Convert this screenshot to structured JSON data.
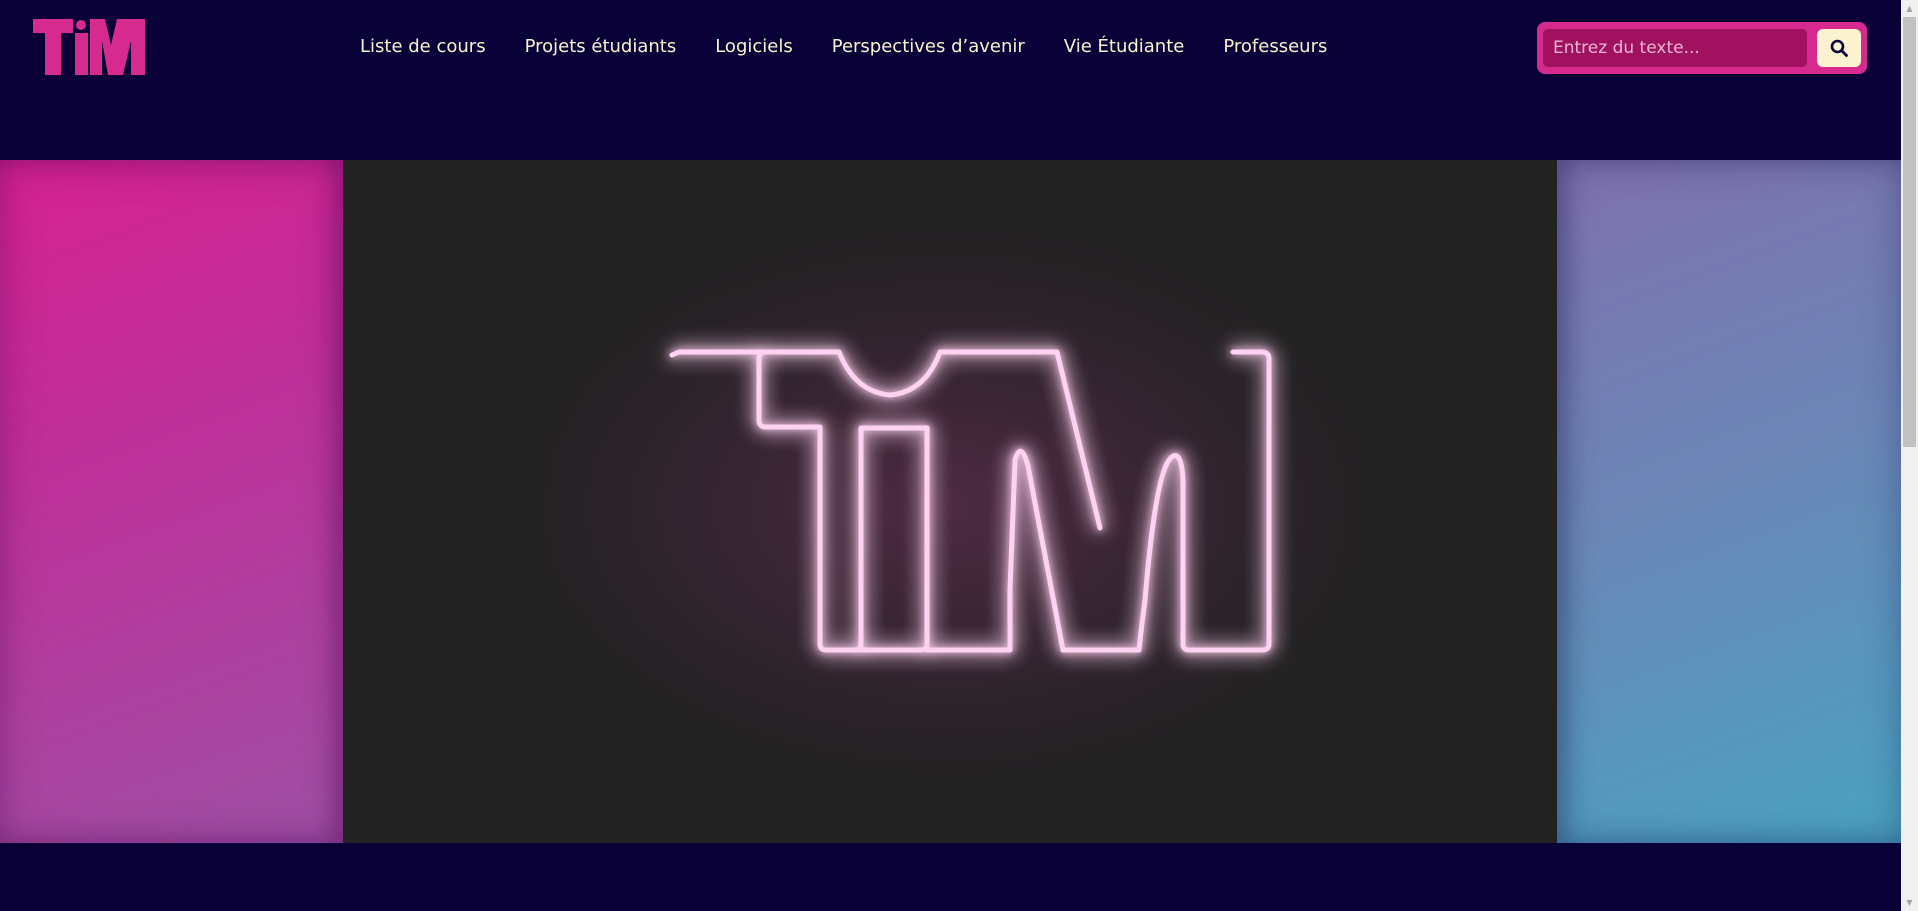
{
  "header": {
    "logo_text": "TiM",
    "nav": [
      {
        "label": "Liste de cours"
      },
      {
        "label": "Projets étudiants"
      },
      {
        "label": "Logiciels"
      },
      {
        "label": "Perspectives d’avenir"
      },
      {
        "label": "Vie Étudiante"
      },
      {
        "label": "Professeurs"
      }
    ],
    "search": {
      "placeholder": "Entrez du texte...",
      "value": "",
      "button_icon": "search-icon"
    }
  },
  "hero": {
    "neon_logo_text": "TiM"
  },
  "colors": {
    "background": "#0a0038",
    "brand_pink": "#d72a8f",
    "nav_text": "#fbf3cf",
    "neon": "#ff6ad5"
  }
}
